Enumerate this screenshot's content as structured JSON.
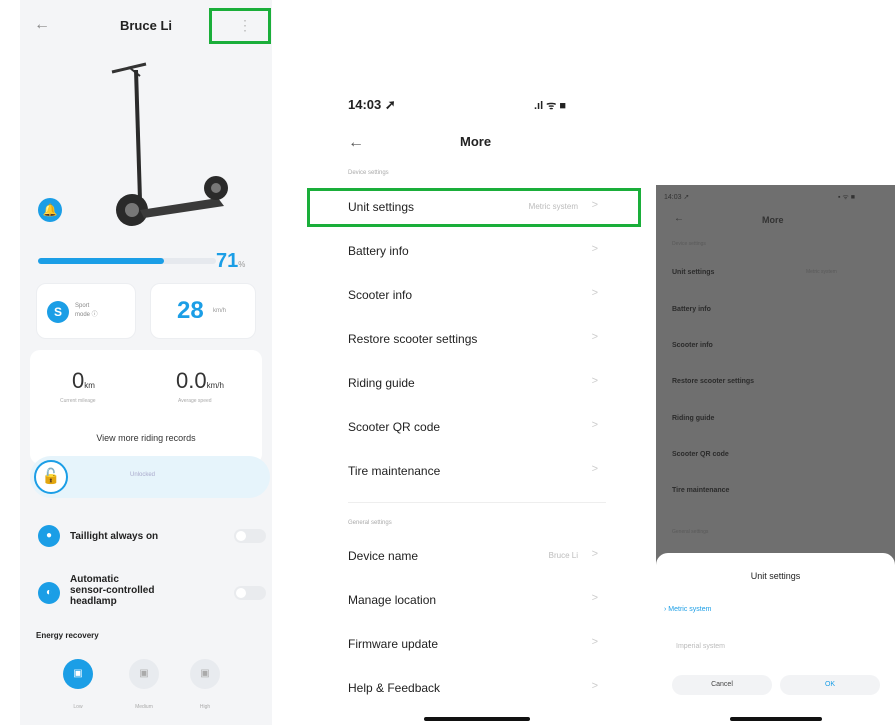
{
  "panel1": {
    "title": "Bruce Li",
    "back_icon": "←",
    "more_icon": "⋮",
    "battery_percent": 71,
    "battery_value": "71",
    "battery_unit": "%",
    "mode_badge": "S",
    "mode_line1": "Sport",
    "mode_line2": "mode ⓘ",
    "speed_value": "28",
    "speed_unit": "km/h",
    "trip_value": "0",
    "trip_unit": "km",
    "trip_label": "Current mileage",
    "avg_value": "0.0",
    "avg_unit": "km/h",
    "avg_label": "Average speed",
    "view_records": "View more riding records",
    "lock_text": "Unlocked",
    "taillight_label": "Taillight always on",
    "headlamp_label_lines": [
      "Automatic",
      "sensor-controlled",
      "headlamp"
    ],
    "energy_title": "Energy recovery",
    "energy_levels": [
      "Low",
      "Medium",
      "High"
    ]
  },
  "panel2": {
    "time": "14:03 ➚",
    "status_icons": ".ıl ᯤ ■",
    "back_icon": "←",
    "title": "More",
    "device_section": "Device settings",
    "general_section": "General settings",
    "device_items": [
      {
        "label": "Unit settings",
        "value": "Metric system"
      },
      {
        "label": "Battery info",
        "value": ""
      },
      {
        "label": "Scooter info",
        "value": ""
      },
      {
        "label": "Restore scooter settings",
        "value": ""
      },
      {
        "label": "Riding guide",
        "value": ""
      },
      {
        "label": "Scooter QR code",
        "value": ""
      },
      {
        "label": "Tire maintenance",
        "value": ""
      }
    ],
    "general_items": [
      {
        "label": "Device name",
        "value": "Bruce Li"
      },
      {
        "label": "Manage location",
        "value": ""
      },
      {
        "label": "Firmware update",
        "value": ""
      },
      {
        "label": "Help & Feedback",
        "value": ""
      }
    ],
    "chevron": ">"
  },
  "panel3": {
    "status_left": "14:03 ➚",
    "status_right": "▪ ᯤ ■",
    "back_icon": "←",
    "title": "More",
    "section": "Device settings",
    "items": [
      "Unit settings",
      "Battery info",
      "Scooter info",
      "Restore scooter settings",
      "Riding guide",
      "Scooter QR code",
      "Tire maintenance"
    ],
    "unit_value": "Metric system",
    "general_section": "General settings",
    "sheet_title": "Unit settings",
    "option_selected": "Metric system",
    "option_other": "Imperial system",
    "cancel": "Cancel",
    "ok": "OK"
  },
  "colors": {
    "accent": "#1b9ee6",
    "highlight_box": "#1aae3a"
  }
}
